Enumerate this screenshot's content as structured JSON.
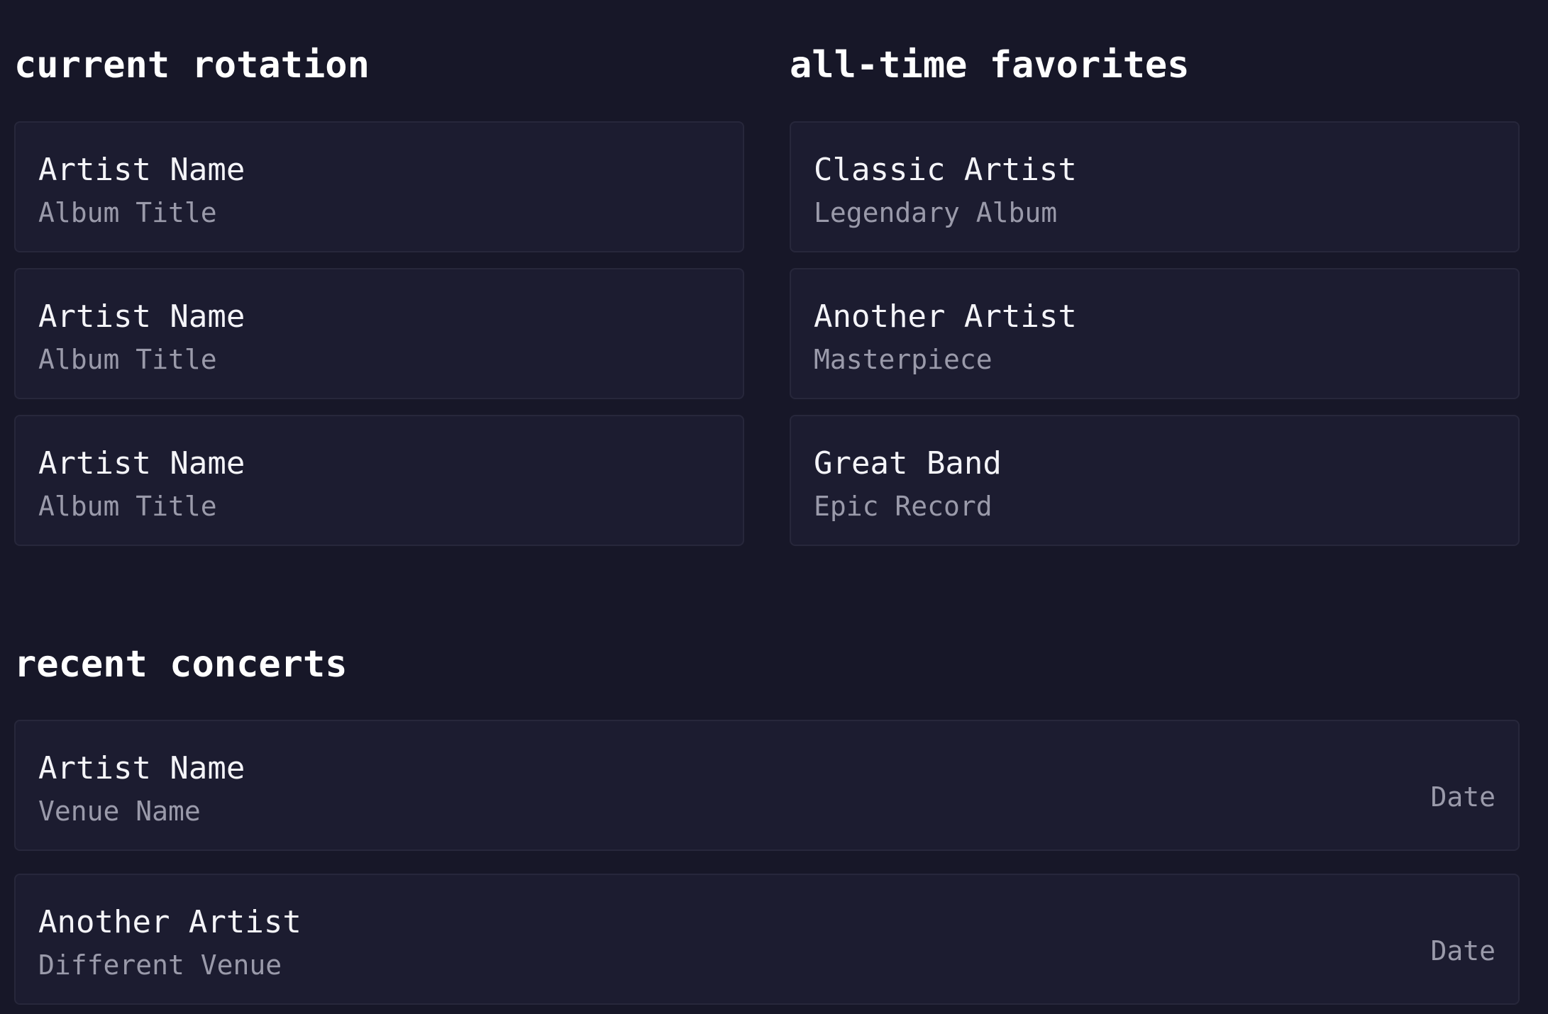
{
  "sections": {
    "current_rotation": {
      "title": "current rotation",
      "items": [
        {
          "artist": "Artist Name",
          "album": "Album Title"
        },
        {
          "artist": "Artist Name",
          "album": "Album Title"
        },
        {
          "artist": "Artist Name",
          "album": "Album Title"
        }
      ]
    },
    "all_time_favorites": {
      "title": "all-time favorites",
      "items": [
        {
          "artist": "Classic Artist",
          "album": "Legendary Album"
        },
        {
          "artist": "Another Artist",
          "album": "Masterpiece"
        },
        {
          "artist": "Great Band",
          "album": "Epic Record"
        }
      ]
    },
    "recent_concerts": {
      "title": "recent concerts",
      "items": [
        {
          "artist": "Artist Name",
          "venue": "Venue Name",
          "date": "Date"
        },
        {
          "artist": "Another Artist",
          "venue": "Different Venue",
          "date": "Date"
        }
      ]
    }
  },
  "colors": {
    "background": "#171728",
    "card": "#1c1c30",
    "card_border": "#27273b",
    "text_primary": "#f4f4f8",
    "text_secondary": "#9a9aaa"
  }
}
